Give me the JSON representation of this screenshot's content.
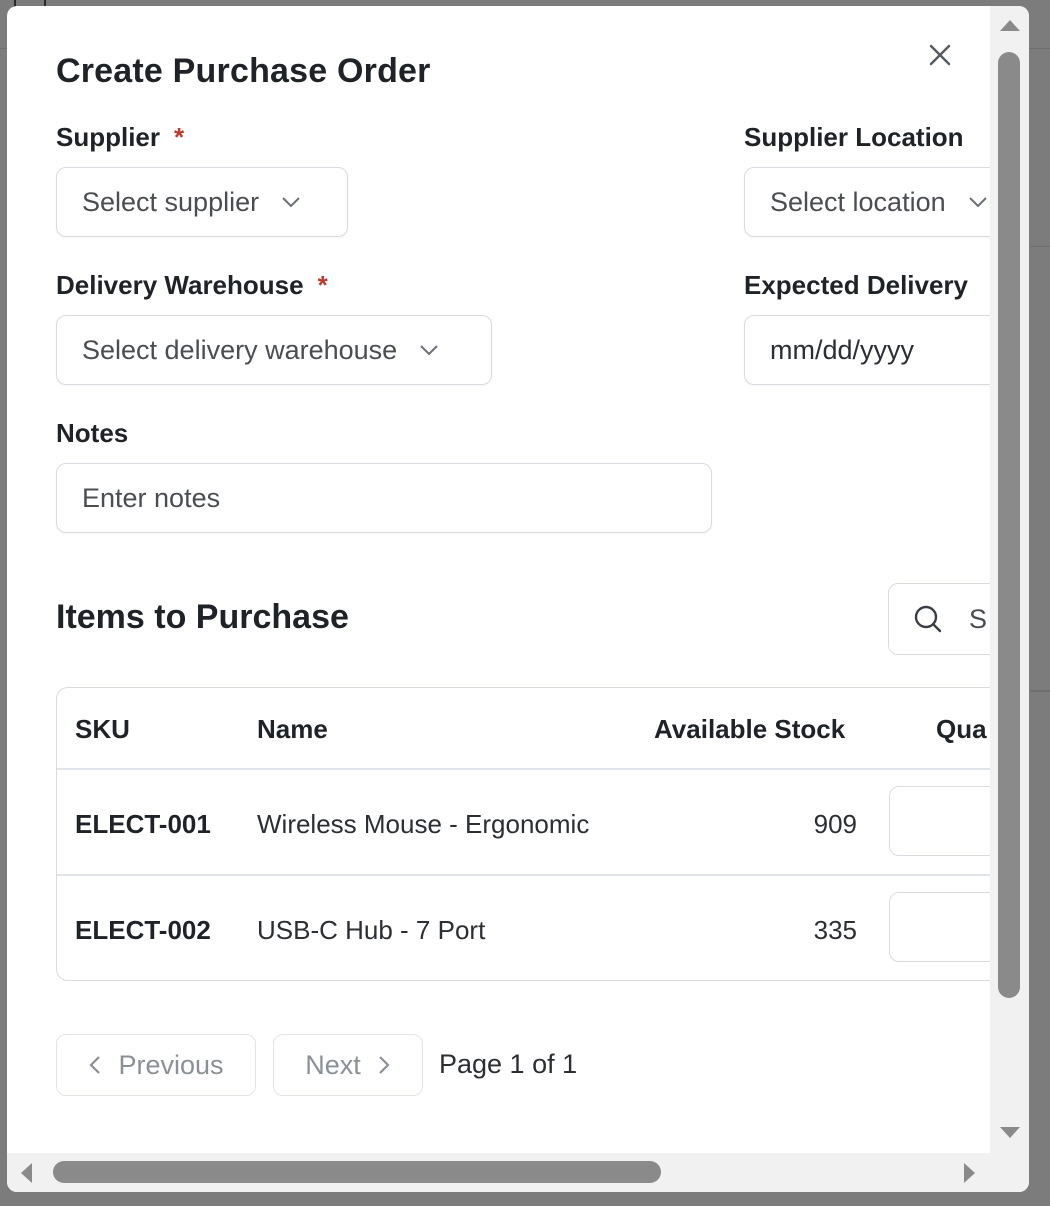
{
  "modal": {
    "title": "Create Purchase Order",
    "close_icon": "close-icon"
  },
  "form": {
    "supplier": {
      "label": "Supplier",
      "required_mark": "*",
      "placeholder": "Select supplier"
    },
    "supplier_location": {
      "label": "Supplier Location",
      "placeholder": "Select location"
    },
    "delivery_warehouse": {
      "label": "Delivery Warehouse",
      "required_mark": "*",
      "placeholder": "Select delivery warehouse"
    },
    "expected_delivery": {
      "label": "Expected Delivery",
      "placeholder": "mm/dd/yyyy"
    },
    "notes": {
      "label": "Notes",
      "placeholder": "Enter notes"
    }
  },
  "items": {
    "title": "Items to Purchase",
    "search_placeholder": "S",
    "columns": [
      "SKU",
      "Name",
      "Available Stock",
      "Qua"
    ],
    "rows": [
      {
        "sku": "ELECT-001",
        "name": "Wireless Mouse - Ergonomic",
        "stock": "909",
        "qty": ""
      },
      {
        "sku": "ELECT-002",
        "name": "USB-C Hub - 7 Port",
        "stock": "335",
        "qty": ""
      }
    ]
  },
  "pagination": {
    "previous_label": "Previous",
    "next_label": "Next",
    "page_info": "Page 1 of 1"
  },
  "colors": {
    "required": "#c0392b",
    "border": "#d8dbe0",
    "text": "#1f2328",
    "muted": "#8b9096"
  }
}
